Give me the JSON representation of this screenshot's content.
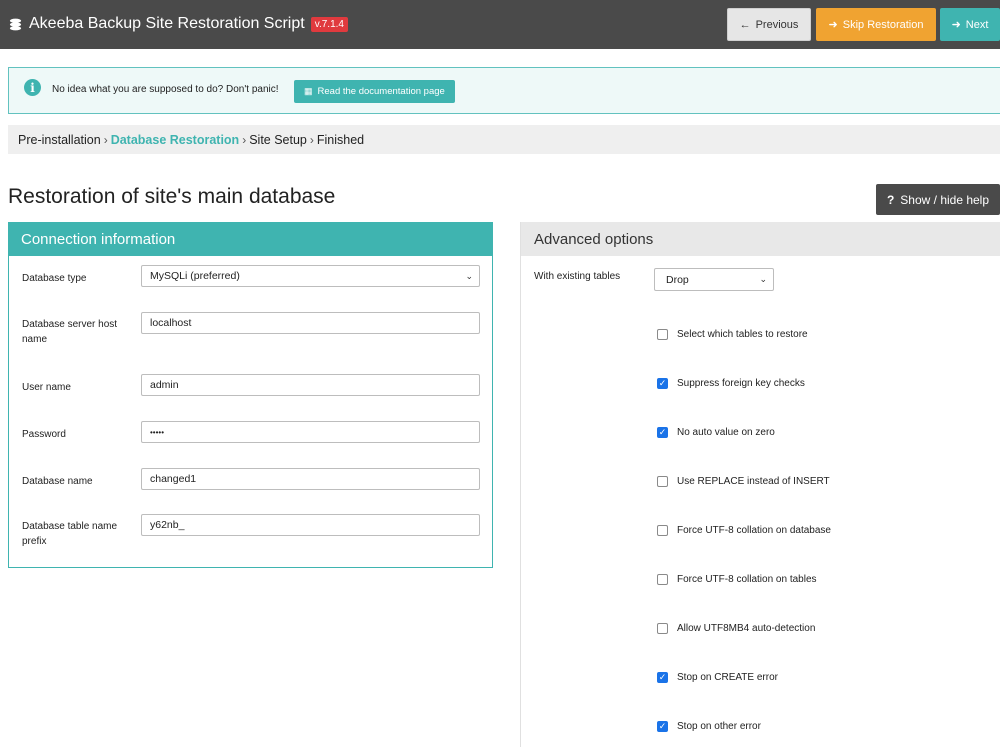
{
  "header": {
    "title": "Akeeba Backup Site Restoration Script",
    "version": "v.7.1.4",
    "logo_icon": "akeeba-logo-icon",
    "buttons": {
      "previous": "Previous",
      "skip": "Skip Restoration",
      "next": "Next"
    }
  },
  "alert": {
    "text": "No idea what you are supposed to do? Don't panic!",
    "doc_button": "Read the documentation page"
  },
  "breadcrumb": {
    "items": [
      "Pre-installation",
      "Database Restoration",
      "Site Setup",
      "Finished"
    ],
    "active_index": 1
  },
  "page": {
    "title": "Restoration of site's main database",
    "help_button": "Show / hide help"
  },
  "connection": {
    "heading": "Connection information",
    "fields": {
      "db_type": {
        "label": "Database type",
        "value": "MySQLi (preferred)"
      },
      "host": {
        "label": "Database server host name",
        "value": "localhost"
      },
      "user": {
        "label": "User name",
        "value": "admin"
      },
      "password": {
        "label": "Password",
        "value": "•••••"
      },
      "db_name": {
        "label": "Database name",
        "value": "changed1"
      },
      "prefix": {
        "label": "Database table name prefix",
        "value": "y62nb_"
      }
    }
  },
  "advanced": {
    "heading": "Advanced options",
    "existing_label": "With existing tables",
    "existing_value": "Drop",
    "options": [
      {
        "label": "Select which tables to restore",
        "checked": false
      },
      {
        "label": "Suppress foreign key checks",
        "checked": true
      },
      {
        "label": "No auto value on zero",
        "checked": true
      },
      {
        "label": "Use REPLACE instead of INSERT",
        "checked": false
      },
      {
        "label": "Force UTF-8 collation on database",
        "checked": false
      },
      {
        "label": "Force UTF-8 collation on tables",
        "checked": false
      },
      {
        "label": "Allow UTF8MB4 auto-detection",
        "checked": false
      },
      {
        "label": "Stop on CREATE error",
        "checked": true
      },
      {
        "label": "Stop on other error",
        "checked": true
      }
    ]
  },
  "colors": {
    "accent": "#3fb4b0",
    "warning": "#f0a331",
    "header_bg": "#4a4a4a",
    "version_badge": "#e03a3e",
    "checkbox": "#1a73e8"
  }
}
